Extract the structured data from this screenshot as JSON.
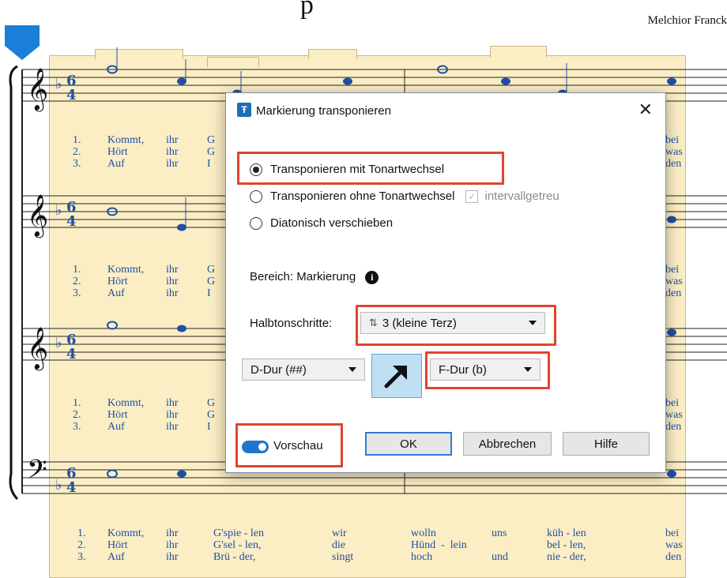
{
  "score": {
    "composer": "Melchior Franck",
    "lyrics_top": [
      {
        "num": "1.",
        "words": [
          "Kommt,",
          "ihr",
          "G"
        ],
        "tail": "bei"
      },
      {
        "num": "2.",
        "words": [
          "Hört",
          "ihr",
          "G"
        ],
        "tail": "was"
      },
      {
        "num": "3.",
        "words": [
          "Auf",
          "ihr",
          "I"
        ],
        "tail": "den"
      }
    ],
    "lyrics_bottom": [
      {
        "num": "1.",
        "words": [
          "Kommt,",
          "ihr",
          "G'spie - len",
          "wir",
          "wolln",
          "uns",
          "küh - len",
          "bei"
        ]
      },
      {
        "num": "2.",
        "words": [
          "Hört",
          "ihr",
          "G'sel - len,",
          "die",
          "Hünd  -  lein",
          "",
          "bel - len,",
          "was"
        ]
      },
      {
        "num": "3.",
        "words": [
          "Auf",
          "ihr",
          "Brü - der,",
          "singt",
          "hoch",
          "und",
          "nie - der,",
          "den"
        ]
      }
    ]
  },
  "dialog": {
    "title": "Markierung transponieren",
    "icon": "app-icon",
    "options": [
      {
        "label": "Transponieren mit Tonartwechsel",
        "selected": true
      },
      {
        "label": "Transponieren ohne Tonartwechsel",
        "selected": false
      },
      {
        "label": "Diatonisch verschieben",
        "selected": false
      }
    ],
    "interval_checkbox": {
      "label": "intervallgetreu",
      "checked": true,
      "enabled": false
    },
    "range_label": "Bereich: Markierung",
    "semitones_label": "Halbtonschritte:",
    "semitones_value": "3 (kleine Terz)",
    "from_key": "D-Dur (##)",
    "to_key": "F-Dur (b)",
    "preview_label": "Vorschau",
    "preview_on": true,
    "buttons": {
      "ok": "OK",
      "cancel": "Abbrechen",
      "help": "Hilfe"
    },
    "colors": {
      "highlight": "#e0452e",
      "accent": "#1f75cc",
      "score_highlight": "#fbeec5",
      "lyrics": "#1f4fa6"
    }
  }
}
